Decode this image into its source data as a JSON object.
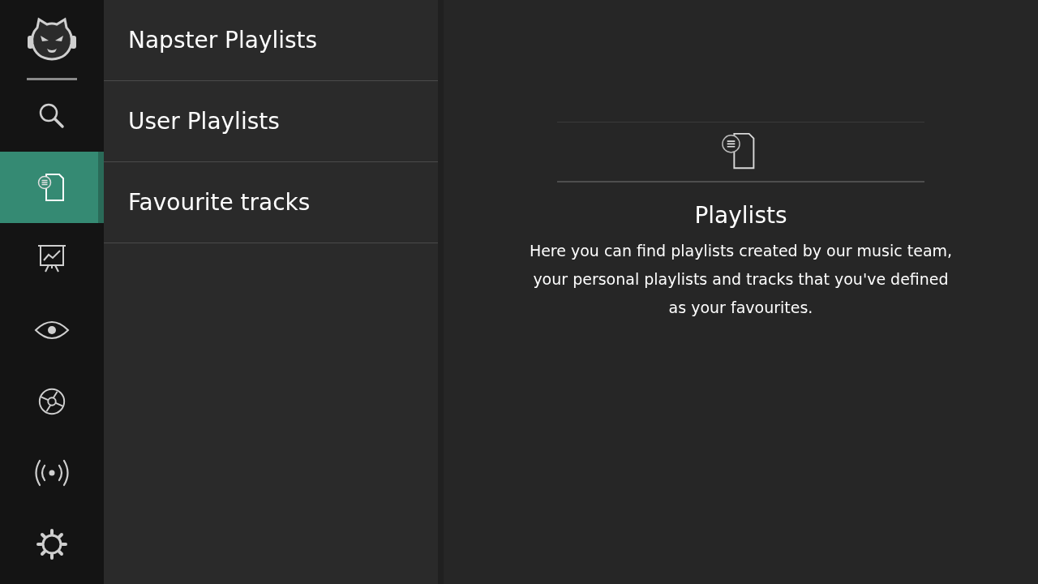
{
  "nav": [
    {
      "kind": "search",
      "selected": false
    },
    {
      "kind": "playlist",
      "selected": true
    },
    {
      "kind": "chart",
      "selected": false
    },
    {
      "kind": "eye",
      "selected": false
    },
    {
      "kind": "disc",
      "selected": false
    },
    {
      "kind": "radio",
      "selected": false
    },
    {
      "kind": "settings",
      "selected": false
    }
  ],
  "menu": [
    {
      "label": "Napster Playlists"
    },
    {
      "label": "User Playlists"
    },
    {
      "label": "Favourite tracks"
    }
  ],
  "content": {
    "title": "Playlists",
    "description": "Here you can find playlists created by our music team, your personal playlists and tracks that you've defined as your favourites."
  }
}
